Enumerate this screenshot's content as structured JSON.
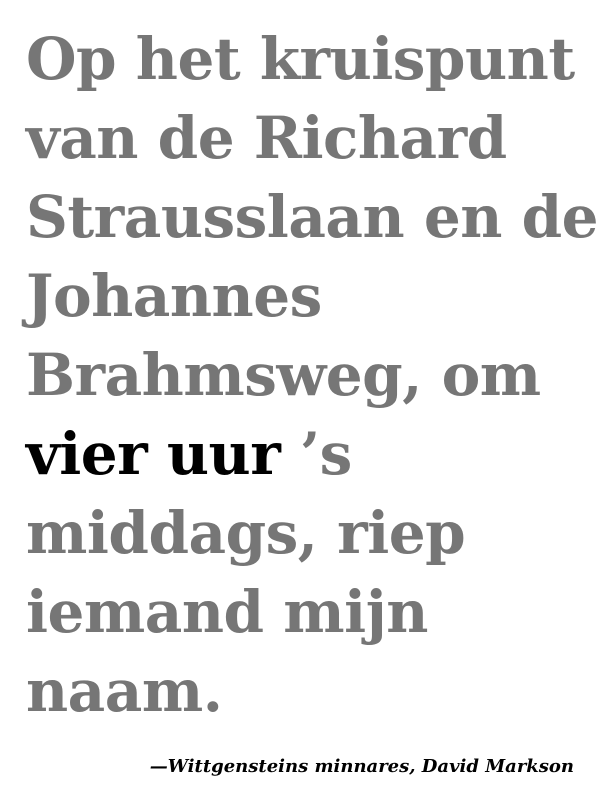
{
  "quote": {
    "lines": [
      "Op het kruispunt",
      "van de Richard",
      "Strausslaan en de",
      "Johannes",
      "Brahmsweg, om"
    ],
    "emphasis": "vier uur",
    "after_emphasis": " ’s",
    "lines_after": [
      "middags, riep",
      "iemand mijn",
      "naam."
    ],
    "text_color": "#767676",
    "emphasis_color": "#000000"
  },
  "attribution": {
    "text": "—Wittgensteins minnares, David Markson"
  }
}
